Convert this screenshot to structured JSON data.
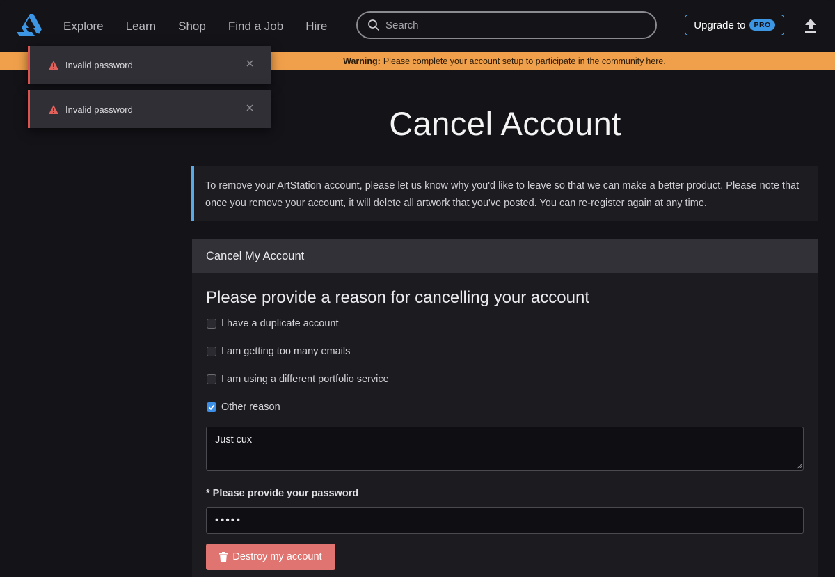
{
  "header": {
    "nav": [
      {
        "label": "Explore"
      },
      {
        "label": "Learn"
      },
      {
        "label": "Shop"
      },
      {
        "label": "Find a Job"
      },
      {
        "label": "Hire"
      }
    ],
    "search_placeholder": "Search",
    "upgrade_label": "Upgrade to",
    "pro_badge": "PRO"
  },
  "warning": {
    "label": "Warning:",
    "text": "Please complete your account setup to participate in the community",
    "link_text": "here",
    "suffix": "."
  },
  "toasts": [
    {
      "message": "Invalid password"
    },
    {
      "message": "Invalid password"
    }
  ],
  "page": {
    "title": "Cancel Account",
    "info_text": "To remove your ArtStation account, please let us know why you'd like to leave so that we can make a better product. Please note that once you remove your account, it will delete all artwork that you've posted. You can re-register again at any time.",
    "panel_title": "Cancel My Account",
    "reason_heading": "Please provide a reason for cancelling your account",
    "reasons": [
      {
        "label": "I have a duplicate account",
        "checked": false
      },
      {
        "label": "I am getting too many emails",
        "checked": false
      },
      {
        "label": "I am using a different portfolio service",
        "checked": false
      },
      {
        "label": "Other reason",
        "checked": true
      }
    ],
    "other_reason_value": "Just cux",
    "password_label": "* Please provide your password",
    "password_value": "•••••",
    "destroy_label": "Destroy my account"
  },
  "colors": {
    "accent_blue": "#5aa9e6",
    "warning_orange": "#f0a04b",
    "danger_red": "#e07470"
  }
}
